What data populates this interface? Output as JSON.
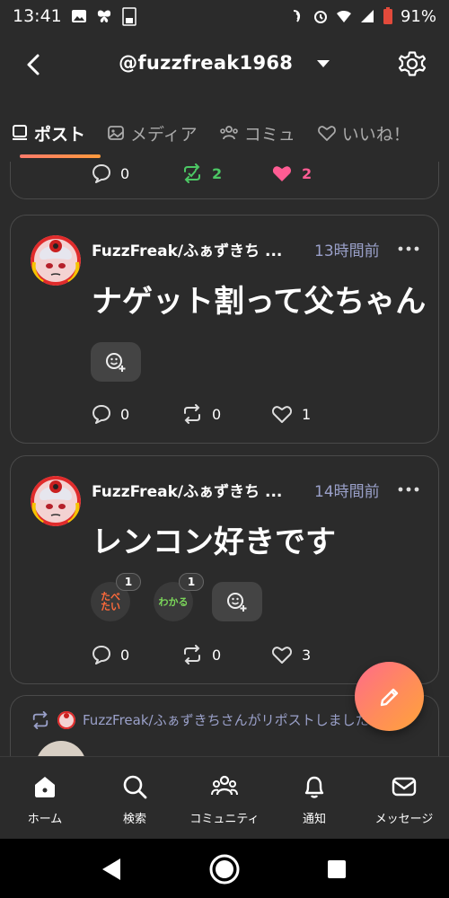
{
  "status_bar": {
    "time": "13:41",
    "battery": "91%"
  },
  "header": {
    "account": "@fuzzfreak1968"
  },
  "tabs": [
    {
      "label": "ポスト",
      "icon": "phone-icon",
      "active": true
    },
    {
      "label": "メディア",
      "icon": "image-icon",
      "active": false
    },
    {
      "label": "コミュ",
      "icon": "community-icon",
      "active": false
    },
    {
      "label": "いいね！",
      "icon": "heart-icon",
      "active": false
    }
  ],
  "partial_card": {
    "replies": "0",
    "reposts": "2",
    "likes": "2"
  },
  "posts": [
    {
      "author": "FuzzFreak/ふぁずきち ...",
      "time": "13時間前",
      "text": "ナゲット割って父ちゃん",
      "replies": "0",
      "reposts": "0",
      "likes": "1"
    },
    {
      "author": "FuzzFreak/ふぁずきち ...",
      "time": "14時間前",
      "text": "レンコン好きです",
      "stamps": [
        {
          "label": "たべ\nたい",
          "count": "1"
        },
        {
          "label": "わかる",
          "count": "1"
        }
      ],
      "replies": "0",
      "reposts": "0",
      "likes": "3"
    }
  ],
  "repost_banner": "FuzzFreak/ふぁずきちさんがリポストしました",
  "bottom_nav": [
    {
      "label": "ホーム",
      "icon": "home-icon"
    },
    {
      "label": "検索",
      "icon": "search-icon"
    },
    {
      "label": "コミュニティ",
      "icon": "community-icon"
    },
    {
      "label": "通知",
      "icon": "bell-icon"
    },
    {
      "label": "メッセージ",
      "icon": "mail-icon"
    }
  ],
  "colors": {
    "background": "#2b2b2b",
    "accent_gradient_start": "#ff6b8a",
    "accent_gradient_end": "#ffa33a",
    "repost_active": "#4cc764",
    "like_active": "#ff5c93",
    "muted_text": "#9aa0c9"
  }
}
